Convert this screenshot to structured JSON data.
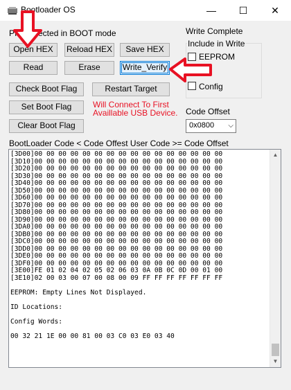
{
  "window": {
    "title": "Bootloader OS",
    "minimize": "—",
    "maximize": "☐",
    "close": "✕"
  },
  "status": {
    "device_text": "PIC Detected in BOOT mode",
    "write_status": "Write Complete",
    "usb_hint": "Will Connect To First Availlable USB Device."
  },
  "buttons": {
    "open_hex": "Open HEX",
    "reload_hex": "Reload HEX",
    "save_hex": "Save HEX",
    "read": "Read",
    "erase": "Erase",
    "write_verify": "Write_Verify",
    "check_boot_flag": "Check Boot Flag",
    "restart_target": "Restart Target",
    "set_boot_flag": "Set Boot Flag",
    "clear_boot_flag": "Clear Boot Flag"
  },
  "include_group": {
    "title": "Include in Write",
    "eeprom_label": "EEPROM",
    "eeprom_checked": false,
    "config_label": "Config",
    "config_checked": false
  },
  "code_offset": {
    "label": "Code Offset",
    "value": "0x0800"
  },
  "dump_header": "BootLoader Code < Code Offest   User Code >= Code Offset",
  "dump": {
    "lines": [
      "[3D00]00 00 00 00 00 00 00 00 00 00 00 00 00 00 00 00",
      "[3D10]00 00 00 00 00 00 00 00 00 00 00 00 00 00 00 00",
      "[3D20]00 00 00 00 00 00 00 00 00 00 00 00 00 00 00 00",
      "[3D30]00 00 00 00 00 00 00 00 00 00 00 00 00 00 00 00",
      "[3D40]00 00 00 00 00 00 00 00 00 00 00 00 00 00 00 00",
      "[3D50]00 00 00 00 00 00 00 00 00 00 00 00 00 00 00 00",
      "[3D60]00 00 00 00 00 00 00 00 00 00 00 00 00 00 00 00",
      "[3D70]00 00 00 00 00 00 00 00 00 00 00 00 00 00 00 00",
      "[3D80]00 00 00 00 00 00 00 00 00 00 00 00 00 00 00 00",
      "[3D90]00 00 00 00 00 00 00 00 00 00 00 00 00 00 00 00",
      "[3DA0]00 00 00 00 00 00 00 00 00 00 00 00 00 00 00 00",
      "[3DB0]00 00 00 00 00 00 00 00 00 00 00 00 00 00 00 00",
      "[3DC0]00 00 00 00 00 00 00 00 00 00 00 00 00 00 00 00",
      "[3DD0]00 00 00 00 00 00 00 00 00 00 00 00 00 00 00 00",
      "[3DE0]00 00 00 00 00 00 00 00 00 00 00 00 00 00 00 00",
      "[3DF0]00 00 00 00 00 00 00 00 00 00 00 00 00 00 00 00",
      "[3E00]FE 01 02 04 02 05 02 06 03 0A 0B 0C 0D 00 01 00",
      "[3E10]02 00 03 00 07 00 08 00 09 FF FF FF FF FF FF FF",
      "",
      "EEPROM: Empty Lines Not Displayed.",
      "",
      "ID Locations:",
      "",
      "Config Words:",
      "",
      "00 32 21 1E 00 00 81 00 03 C0 03 E0 03 40"
    ]
  },
  "scroll": {
    "up": "▲",
    "down": "▼"
  },
  "annotations": {
    "arrow_color": "#e81123"
  }
}
